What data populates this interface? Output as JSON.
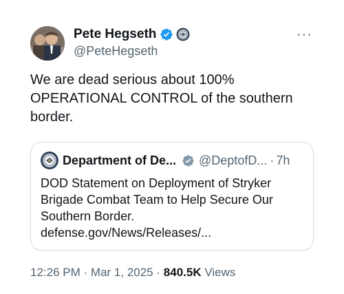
{
  "top_cut_text": "",
  "author": {
    "display_name": "Pete Hegseth",
    "handle": "@PeteHegseth",
    "verified_icon": "verified-check-icon",
    "affiliation_icon": "dod-seal-icon"
  },
  "more_icon": "···",
  "tweet": {
    "text": "We are dead serious about 100% OPERATIONAL CONTROL of the southern border."
  },
  "quote": {
    "display_name": "Department of De...",
    "handle": "@DeptofD...",
    "separator": "·",
    "time": "7h",
    "body": "DOD Statement on Deployment of Stryker Brigade Combat Team to Help Secure Our Southern Border. defense.gov/News/Releases/..."
  },
  "meta": {
    "time": "12:26 PM",
    "dot1": "·",
    "date": "Mar 1, 2025",
    "dot2": "·",
    "views_count": "840.5K",
    "views_label": "Views"
  },
  "colors": {
    "accent": "#1d9bf0",
    "secondary_text": "#536471",
    "primary_text": "#0f1419",
    "border": "#cfd9de"
  }
}
